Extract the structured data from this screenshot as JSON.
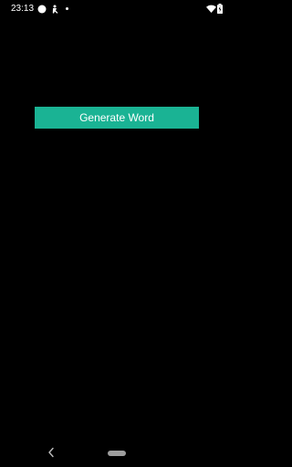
{
  "status_bar": {
    "time": "23:13",
    "notification_icons": [
      "circle-notification-icon",
      "accessibility-notification-icon",
      "more-notifications-dot-icon"
    ],
    "system_icons": [
      "wifi-icon",
      "battery-icon"
    ]
  },
  "main": {
    "generate_button_label": "Generate Word"
  },
  "navigation": {
    "icons": [
      "back-icon",
      "home-pill-icon"
    ]
  },
  "colors": {
    "background": "#000000",
    "button": "#1ab394",
    "button_text": "#ffffff"
  }
}
